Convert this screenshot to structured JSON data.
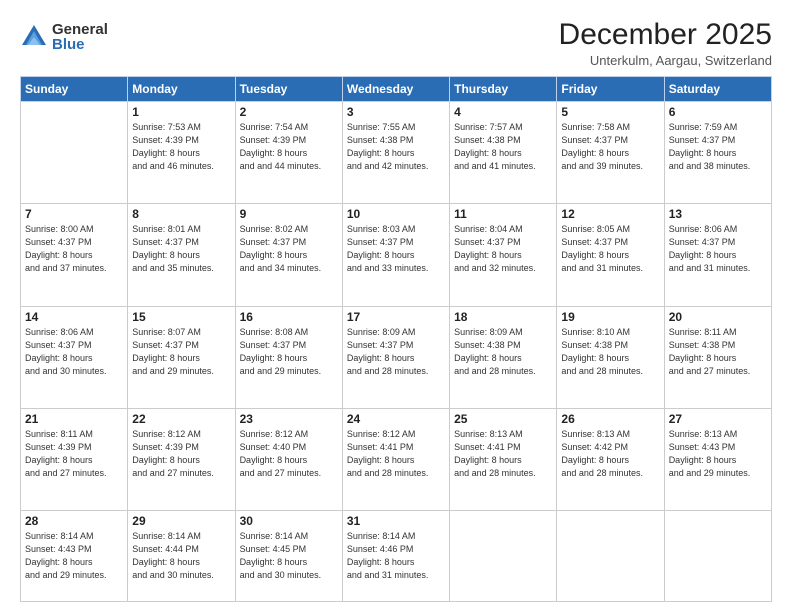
{
  "logo": {
    "general": "General",
    "blue": "Blue"
  },
  "title": "December 2025",
  "location": "Unterkulm, Aargau, Switzerland",
  "days_of_week": [
    "Sunday",
    "Monday",
    "Tuesday",
    "Wednesday",
    "Thursday",
    "Friday",
    "Saturday"
  ],
  "weeks": [
    [
      {
        "day": "",
        "sunrise": "",
        "sunset": "",
        "daylight": ""
      },
      {
        "day": "1",
        "sunrise": "Sunrise: 7:53 AM",
        "sunset": "Sunset: 4:39 PM",
        "daylight": "Daylight: 8 hours and 46 minutes."
      },
      {
        "day": "2",
        "sunrise": "Sunrise: 7:54 AM",
        "sunset": "Sunset: 4:39 PM",
        "daylight": "Daylight: 8 hours and 44 minutes."
      },
      {
        "day": "3",
        "sunrise": "Sunrise: 7:55 AM",
        "sunset": "Sunset: 4:38 PM",
        "daylight": "Daylight: 8 hours and 42 minutes."
      },
      {
        "day": "4",
        "sunrise": "Sunrise: 7:57 AM",
        "sunset": "Sunset: 4:38 PM",
        "daylight": "Daylight: 8 hours and 41 minutes."
      },
      {
        "day": "5",
        "sunrise": "Sunrise: 7:58 AM",
        "sunset": "Sunset: 4:37 PM",
        "daylight": "Daylight: 8 hours and 39 minutes."
      },
      {
        "day": "6",
        "sunrise": "Sunrise: 7:59 AM",
        "sunset": "Sunset: 4:37 PM",
        "daylight": "Daylight: 8 hours and 38 minutes."
      }
    ],
    [
      {
        "day": "7",
        "sunrise": "Sunrise: 8:00 AM",
        "sunset": "Sunset: 4:37 PM",
        "daylight": "Daylight: 8 hours and 37 minutes."
      },
      {
        "day": "8",
        "sunrise": "Sunrise: 8:01 AM",
        "sunset": "Sunset: 4:37 PM",
        "daylight": "Daylight: 8 hours and 35 minutes."
      },
      {
        "day": "9",
        "sunrise": "Sunrise: 8:02 AM",
        "sunset": "Sunset: 4:37 PM",
        "daylight": "Daylight: 8 hours and 34 minutes."
      },
      {
        "day": "10",
        "sunrise": "Sunrise: 8:03 AM",
        "sunset": "Sunset: 4:37 PM",
        "daylight": "Daylight: 8 hours and 33 minutes."
      },
      {
        "day": "11",
        "sunrise": "Sunrise: 8:04 AM",
        "sunset": "Sunset: 4:37 PM",
        "daylight": "Daylight: 8 hours and 32 minutes."
      },
      {
        "day": "12",
        "sunrise": "Sunrise: 8:05 AM",
        "sunset": "Sunset: 4:37 PM",
        "daylight": "Daylight: 8 hours and 31 minutes."
      },
      {
        "day": "13",
        "sunrise": "Sunrise: 8:06 AM",
        "sunset": "Sunset: 4:37 PM",
        "daylight": "Daylight: 8 hours and 31 minutes."
      }
    ],
    [
      {
        "day": "14",
        "sunrise": "Sunrise: 8:06 AM",
        "sunset": "Sunset: 4:37 PM",
        "daylight": "Daylight: 8 hours and 30 minutes."
      },
      {
        "day": "15",
        "sunrise": "Sunrise: 8:07 AM",
        "sunset": "Sunset: 4:37 PM",
        "daylight": "Daylight: 8 hours and 29 minutes."
      },
      {
        "day": "16",
        "sunrise": "Sunrise: 8:08 AM",
        "sunset": "Sunset: 4:37 PM",
        "daylight": "Daylight: 8 hours and 29 minutes."
      },
      {
        "day": "17",
        "sunrise": "Sunrise: 8:09 AM",
        "sunset": "Sunset: 4:37 PM",
        "daylight": "Daylight: 8 hours and 28 minutes."
      },
      {
        "day": "18",
        "sunrise": "Sunrise: 8:09 AM",
        "sunset": "Sunset: 4:38 PM",
        "daylight": "Daylight: 8 hours and 28 minutes."
      },
      {
        "day": "19",
        "sunrise": "Sunrise: 8:10 AM",
        "sunset": "Sunset: 4:38 PM",
        "daylight": "Daylight: 8 hours and 28 minutes."
      },
      {
        "day": "20",
        "sunrise": "Sunrise: 8:11 AM",
        "sunset": "Sunset: 4:38 PM",
        "daylight": "Daylight: 8 hours and 27 minutes."
      }
    ],
    [
      {
        "day": "21",
        "sunrise": "Sunrise: 8:11 AM",
        "sunset": "Sunset: 4:39 PM",
        "daylight": "Daylight: 8 hours and 27 minutes."
      },
      {
        "day": "22",
        "sunrise": "Sunrise: 8:12 AM",
        "sunset": "Sunset: 4:39 PM",
        "daylight": "Daylight: 8 hours and 27 minutes."
      },
      {
        "day": "23",
        "sunrise": "Sunrise: 8:12 AM",
        "sunset": "Sunset: 4:40 PM",
        "daylight": "Daylight: 8 hours and 27 minutes."
      },
      {
        "day": "24",
        "sunrise": "Sunrise: 8:12 AM",
        "sunset": "Sunset: 4:41 PM",
        "daylight": "Daylight: 8 hours and 28 minutes."
      },
      {
        "day": "25",
        "sunrise": "Sunrise: 8:13 AM",
        "sunset": "Sunset: 4:41 PM",
        "daylight": "Daylight: 8 hours and 28 minutes."
      },
      {
        "day": "26",
        "sunrise": "Sunrise: 8:13 AM",
        "sunset": "Sunset: 4:42 PM",
        "daylight": "Daylight: 8 hours and 28 minutes."
      },
      {
        "day": "27",
        "sunrise": "Sunrise: 8:13 AM",
        "sunset": "Sunset: 4:43 PM",
        "daylight": "Daylight: 8 hours and 29 minutes."
      }
    ],
    [
      {
        "day": "28",
        "sunrise": "Sunrise: 8:14 AM",
        "sunset": "Sunset: 4:43 PM",
        "daylight": "Daylight: 8 hours and 29 minutes."
      },
      {
        "day": "29",
        "sunrise": "Sunrise: 8:14 AM",
        "sunset": "Sunset: 4:44 PM",
        "daylight": "Daylight: 8 hours and 30 minutes."
      },
      {
        "day": "30",
        "sunrise": "Sunrise: 8:14 AM",
        "sunset": "Sunset: 4:45 PM",
        "daylight": "Daylight: 8 hours and 30 minutes."
      },
      {
        "day": "31",
        "sunrise": "Sunrise: 8:14 AM",
        "sunset": "Sunset: 4:46 PM",
        "daylight": "Daylight: 8 hours and 31 minutes."
      },
      {
        "day": "",
        "sunrise": "",
        "sunset": "",
        "daylight": ""
      },
      {
        "day": "",
        "sunrise": "",
        "sunset": "",
        "daylight": ""
      },
      {
        "day": "",
        "sunrise": "",
        "sunset": "",
        "daylight": ""
      }
    ]
  ]
}
